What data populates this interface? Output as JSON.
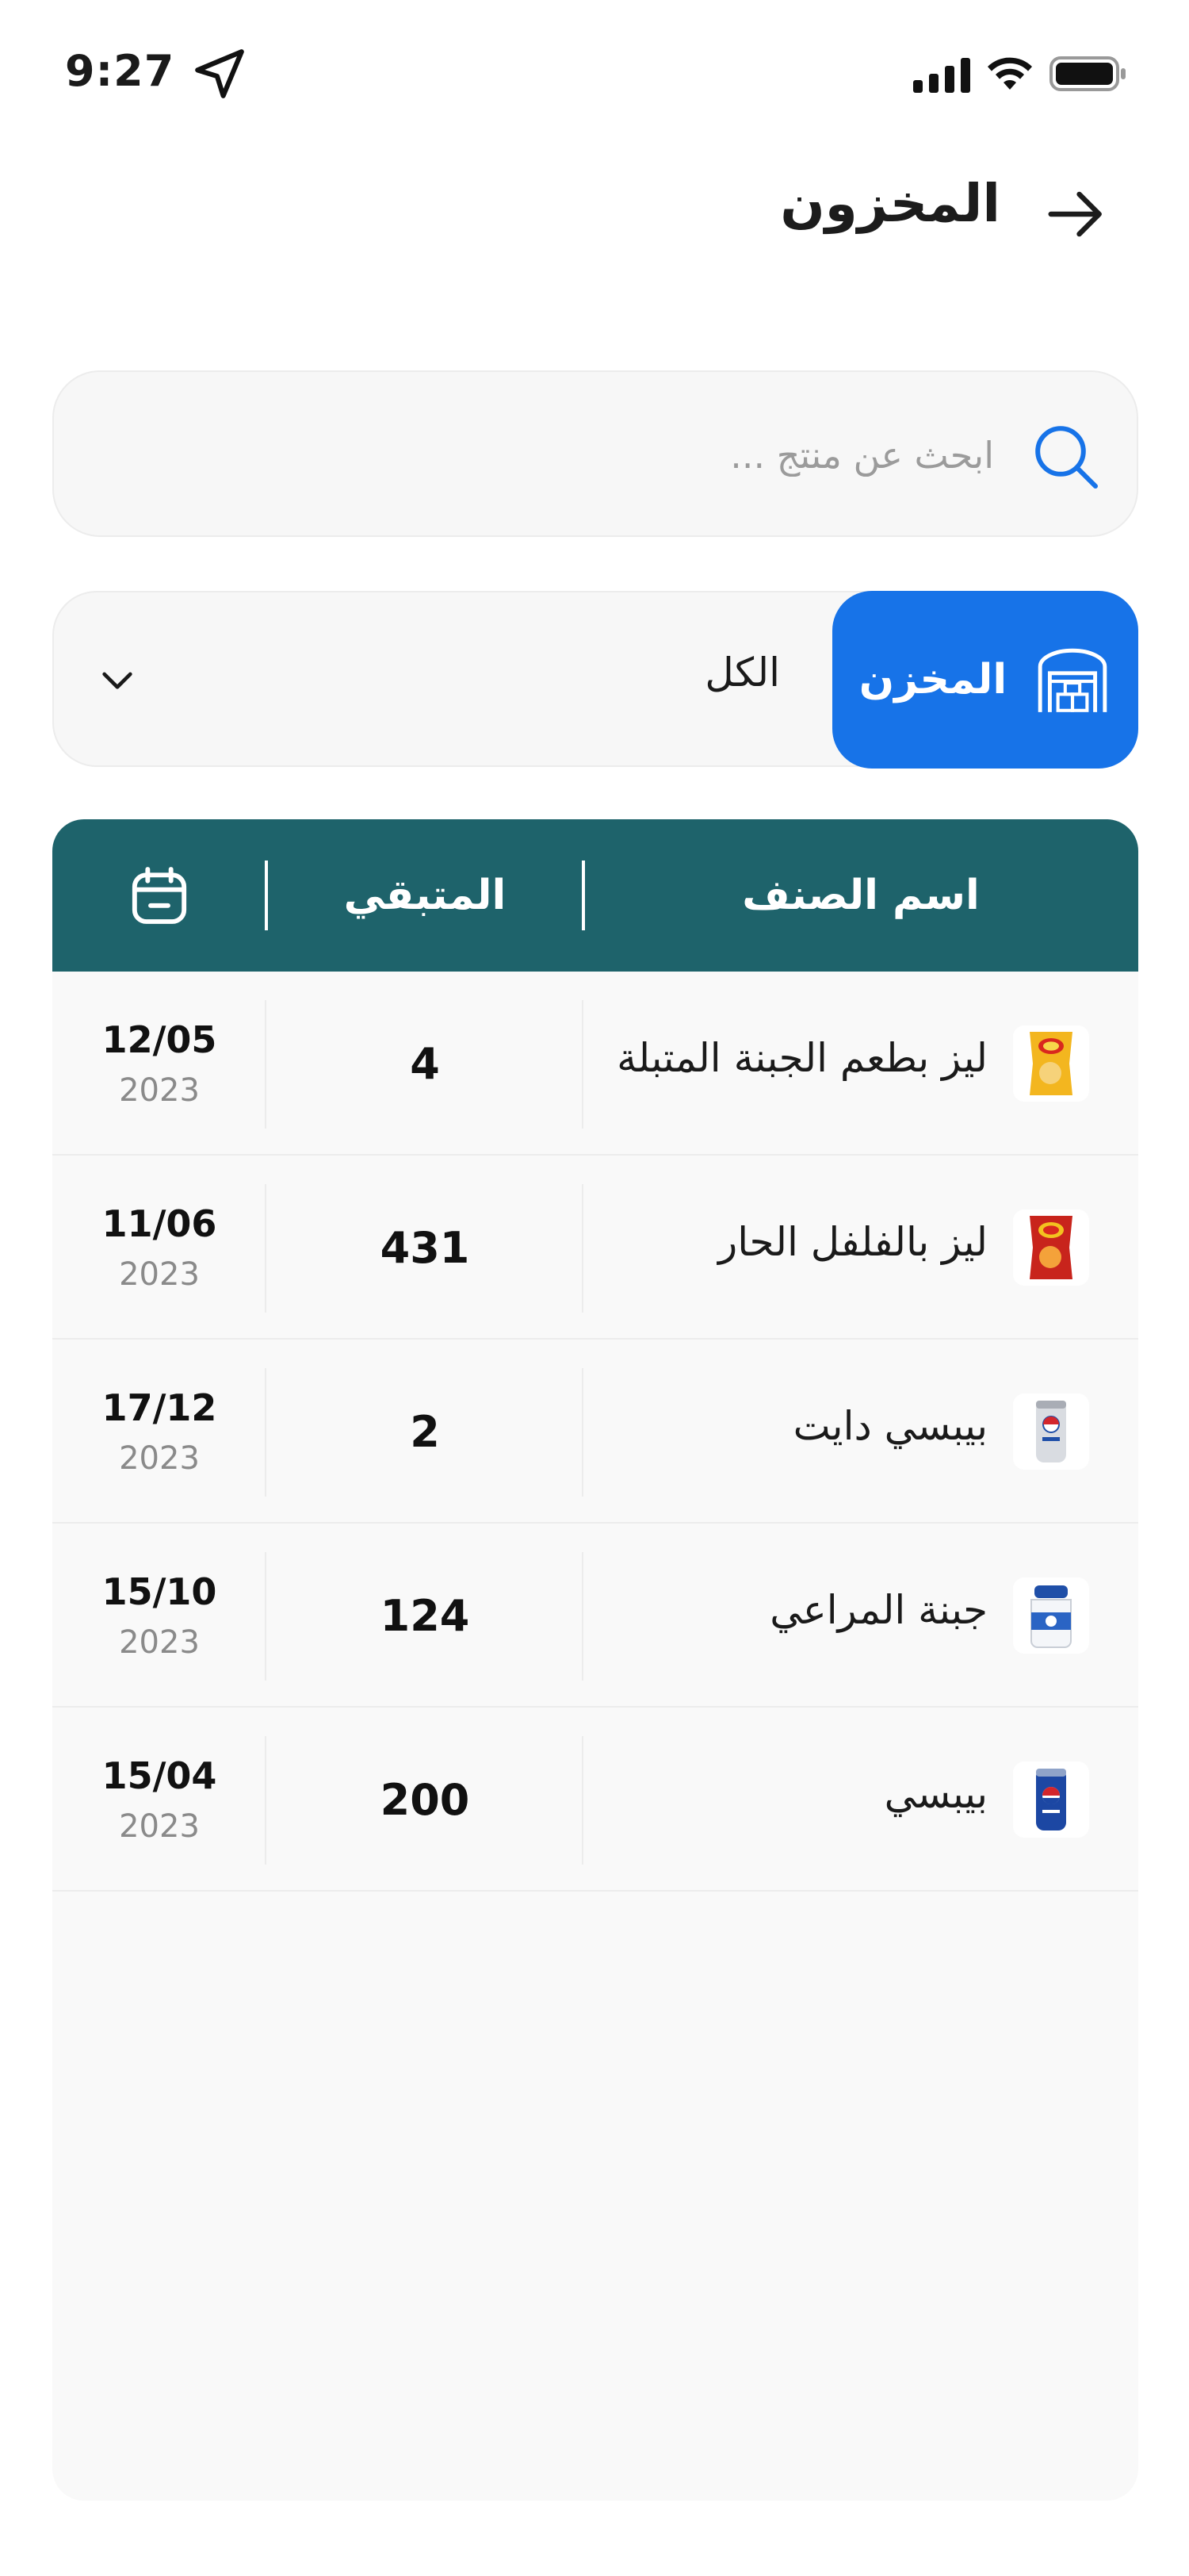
{
  "status_bar": {
    "time": "9:27"
  },
  "header": {
    "title": "المخزون"
  },
  "search": {
    "placeholder": "ابحث عن منتج ..."
  },
  "filter": {
    "tab_label": "المخزن",
    "selected_value": "الكل"
  },
  "table": {
    "headers": {
      "name": "اسم الصنف",
      "remaining": "المتبقي"
    },
    "rows": [
      {
        "name": "ليز بطعم الجبنة المتبلة",
        "remaining": "4",
        "date": "12/05",
        "year": "2023",
        "icon": "lays-chips-yellow-icon"
      },
      {
        "name": "ليز بالفلفل الحار",
        "remaining": "431",
        "date": "11/06",
        "year": "2023",
        "icon": "lays-chips-red-icon"
      },
      {
        "name": "بيبسي دايت",
        "remaining": "2",
        "date": "17/12",
        "year": "2023",
        "icon": "diet-pepsi-can-icon"
      },
      {
        "name": "جبنة المراعي",
        "remaining": "124",
        "date": "15/10",
        "year": "2023",
        "icon": "almarai-cheese-jar-icon"
      },
      {
        "name": "بيبسي",
        "remaining": "200",
        "date": "15/04",
        "year": "2023",
        "icon": "pepsi-can-icon"
      }
    ]
  },
  "colors": {
    "accent": "#1773e8",
    "table_header": "#1e636b",
    "surface": "#f7f7f7"
  }
}
